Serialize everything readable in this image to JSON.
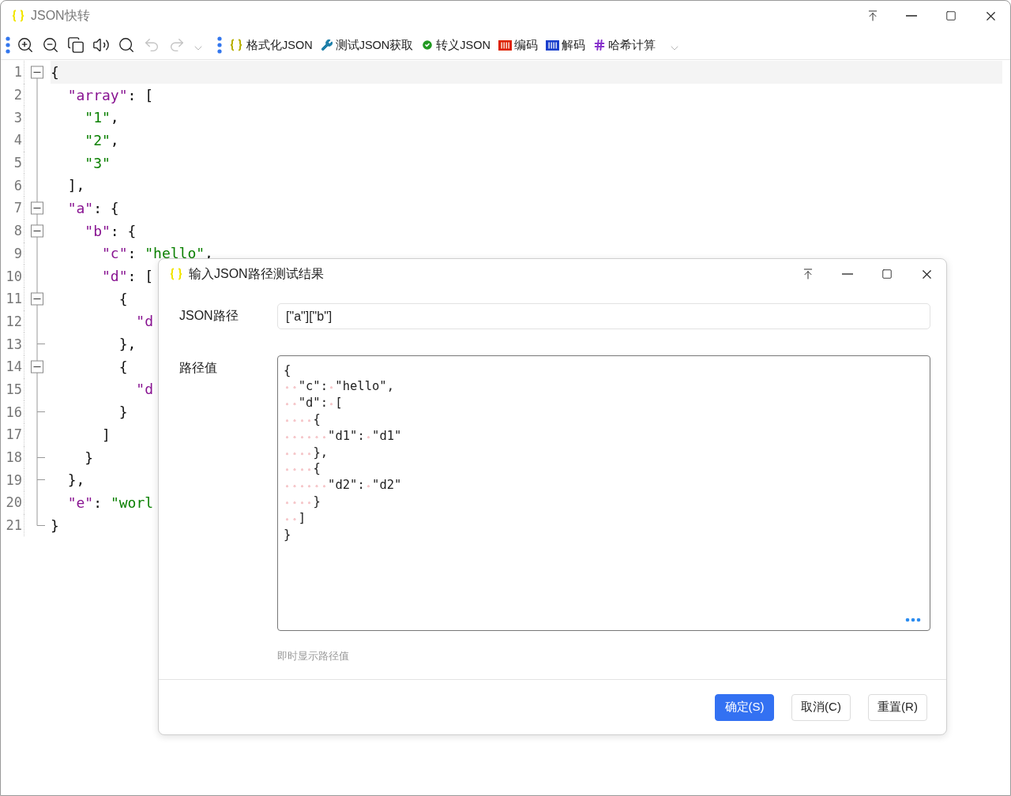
{
  "window": {
    "title": "JSON快转",
    "controls": [
      {
        "kind": "pin"
      },
      {
        "kind": "minimize"
      },
      {
        "kind": "maximize"
      },
      {
        "kind": "close"
      }
    ]
  },
  "toolbar": {
    "icons": [
      {
        "kind": "zoom-in",
        "disabled": false
      },
      {
        "kind": "zoom-out",
        "disabled": false
      },
      {
        "kind": "copy",
        "disabled": false
      },
      {
        "kind": "speaker",
        "disabled": false
      },
      {
        "kind": "search",
        "disabled": false
      },
      {
        "kind": "undo",
        "disabled": true
      },
      {
        "kind": "redo",
        "disabled": true
      }
    ],
    "actions": [
      {
        "kind": "format",
        "label": "格式化JSON"
      },
      {
        "kind": "wrench",
        "label": "测试JSON获取"
      },
      {
        "kind": "check",
        "label": "转义JSON"
      },
      {
        "kind": "encode",
        "label": "编码"
      },
      {
        "kind": "decode",
        "label": "解码"
      },
      {
        "kind": "hash",
        "label": "哈希计算"
      }
    ]
  },
  "editor": {
    "lines": [
      {
        "number": "1",
        "kind": "minus",
        "tokens": [
          {
            "kind": "punct",
            "text": "{"
          }
        ]
      },
      {
        "number": "2",
        "kind": "line",
        "tokens": [
          {
            "kind": "key",
            "text": "  \"array\""
          },
          {
            "kind": "punct",
            "text": ": ["
          }
        ]
      },
      {
        "number": "3",
        "kind": "line",
        "tokens": [
          {
            "kind": "string",
            "text": "    \"1\""
          },
          {
            "kind": "punct",
            "text": ","
          }
        ]
      },
      {
        "number": "4",
        "kind": "line",
        "tokens": [
          {
            "kind": "string",
            "text": "    \"2\""
          },
          {
            "kind": "punct",
            "text": ","
          }
        ]
      },
      {
        "number": "5",
        "kind": "line",
        "tokens": [
          {
            "kind": "string",
            "text": "    \"3\""
          }
        ]
      },
      {
        "number": "6",
        "kind": "line",
        "tokens": [
          {
            "kind": "punct",
            "text": "  ],"
          }
        ]
      },
      {
        "number": "7",
        "kind": "minus",
        "tokens": [
          {
            "kind": "key",
            "text": "  \"a\""
          },
          {
            "kind": "punct",
            "text": ": {"
          }
        ]
      },
      {
        "number": "8",
        "kind": "minus",
        "tokens": [
          {
            "kind": "key",
            "text": "    \"b\""
          },
          {
            "kind": "punct",
            "text": ": {"
          }
        ]
      },
      {
        "number": "9",
        "kind": "line",
        "tokens": [
          {
            "kind": "key",
            "text": "      \"c\""
          },
          {
            "kind": "punct",
            "text": ": "
          },
          {
            "kind": "string",
            "text": "\"hello\""
          },
          {
            "kind": "punct",
            "text": ","
          }
        ]
      },
      {
        "number": "10",
        "kind": "line",
        "tokens": [
          {
            "kind": "key",
            "text": "      \"d\""
          },
          {
            "kind": "punct",
            "text": ": ["
          }
        ]
      },
      {
        "number": "11",
        "kind": "minus",
        "tokens": [
          {
            "kind": "punct",
            "text": "        {"
          }
        ]
      },
      {
        "number": "12",
        "kind": "line",
        "tokens": [
          {
            "kind": "key",
            "text": "          \"d"
          }
        ]
      },
      {
        "number": "13",
        "kind": "tick",
        "tokens": [
          {
            "kind": "punct",
            "text": "        },"
          }
        ]
      },
      {
        "number": "14",
        "kind": "minus",
        "tokens": [
          {
            "kind": "punct",
            "text": "        {"
          }
        ]
      },
      {
        "number": "15",
        "kind": "line",
        "tokens": [
          {
            "kind": "key",
            "text": "          \"d"
          }
        ]
      },
      {
        "number": "16",
        "kind": "tick",
        "tokens": [
          {
            "kind": "punct",
            "text": "        }"
          }
        ]
      },
      {
        "number": "17",
        "kind": "line",
        "tokens": [
          {
            "kind": "punct",
            "text": "      ]"
          }
        ]
      },
      {
        "number": "18",
        "kind": "tick",
        "tokens": [
          {
            "kind": "punct",
            "text": "    }"
          }
        ]
      },
      {
        "number": "19",
        "kind": "tick",
        "tokens": [
          {
            "kind": "punct",
            "text": "  },"
          }
        ]
      },
      {
        "number": "20",
        "kind": "line",
        "tokens": [
          {
            "kind": "key",
            "text": "  \"e\""
          },
          {
            "kind": "punct",
            "text": ": "
          },
          {
            "kind": "string",
            "text": "\"worl"
          }
        ]
      },
      {
        "number": "21",
        "kind": "end",
        "tokens": [
          {
            "kind": "punct",
            "text": "}"
          }
        ]
      }
    ]
  },
  "dialog": {
    "title": "输入JSON路径测试结果",
    "controls": [
      {
        "kind": "pin"
      },
      {
        "kind": "minimize"
      },
      {
        "kind": "maximize"
      },
      {
        "kind": "close"
      }
    ],
    "path_label": "JSON路径",
    "path_value": "[\"a\"][\"b\"]",
    "value_label": "路径值",
    "value_text": "{\n  \"c\": \"hello\",\n  \"d\": [\n    {\n      \"d1\": \"d1\"\n    },\n    {\n      \"d2\": \"d2\"\n    }\n  ]\n}",
    "hint": "即时显示路径值",
    "buttons": [
      {
        "kind": "primary",
        "label": "确定(S)"
      },
      {
        "kind": "default",
        "label": "取消(C)"
      },
      {
        "kind": "default",
        "label": "重置(R)"
      }
    ]
  }
}
